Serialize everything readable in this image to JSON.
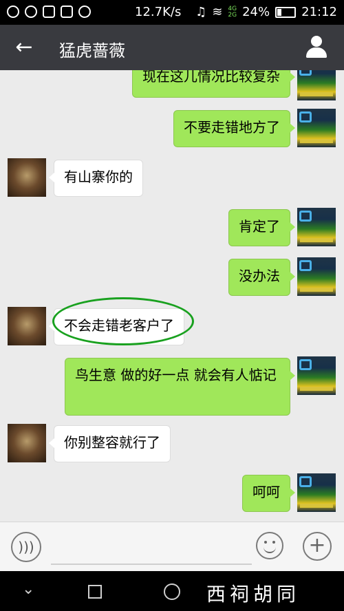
{
  "status_bar": {
    "net_speed": "12.7K/s",
    "network_label_top": "4G",
    "network_label_bottom": "2G",
    "battery": "24%",
    "time": "21:12"
  },
  "header": {
    "back_icon": "←",
    "title": "猛虎蔷薇"
  },
  "messages": [
    {
      "side": "me",
      "text": "现在这儿情况比较复杂"
    },
    {
      "side": "me",
      "text": "不要走错地方了"
    },
    {
      "side": "other",
      "text": "有山寨你的"
    },
    {
      "side": "me",
      "text": "肯定了"
    },
    {
      "side": "me",
      "text": "没办法"
    },
    {
      "side": "other",
      "text": "不会走错老客户了"
    },
    {
      "side": "me",
      "text": "鸟生意 做的好一点 就会有人惦记"
    },
    {
      "side": "other",
      "text": "你别整容就行了"
    },
    {
      "side": "me",
      "text": "呵呵"
    }
  ],
  "input_bar": {
    "voice_icon": "voice-icon",
    "emoji_icon": "emoji-icon",
    "plus_icon": "+"
  },
  "nav_bar": {
    "back_glyph": "⌄",
    "watermark": "西祠胡同"
  }
}
